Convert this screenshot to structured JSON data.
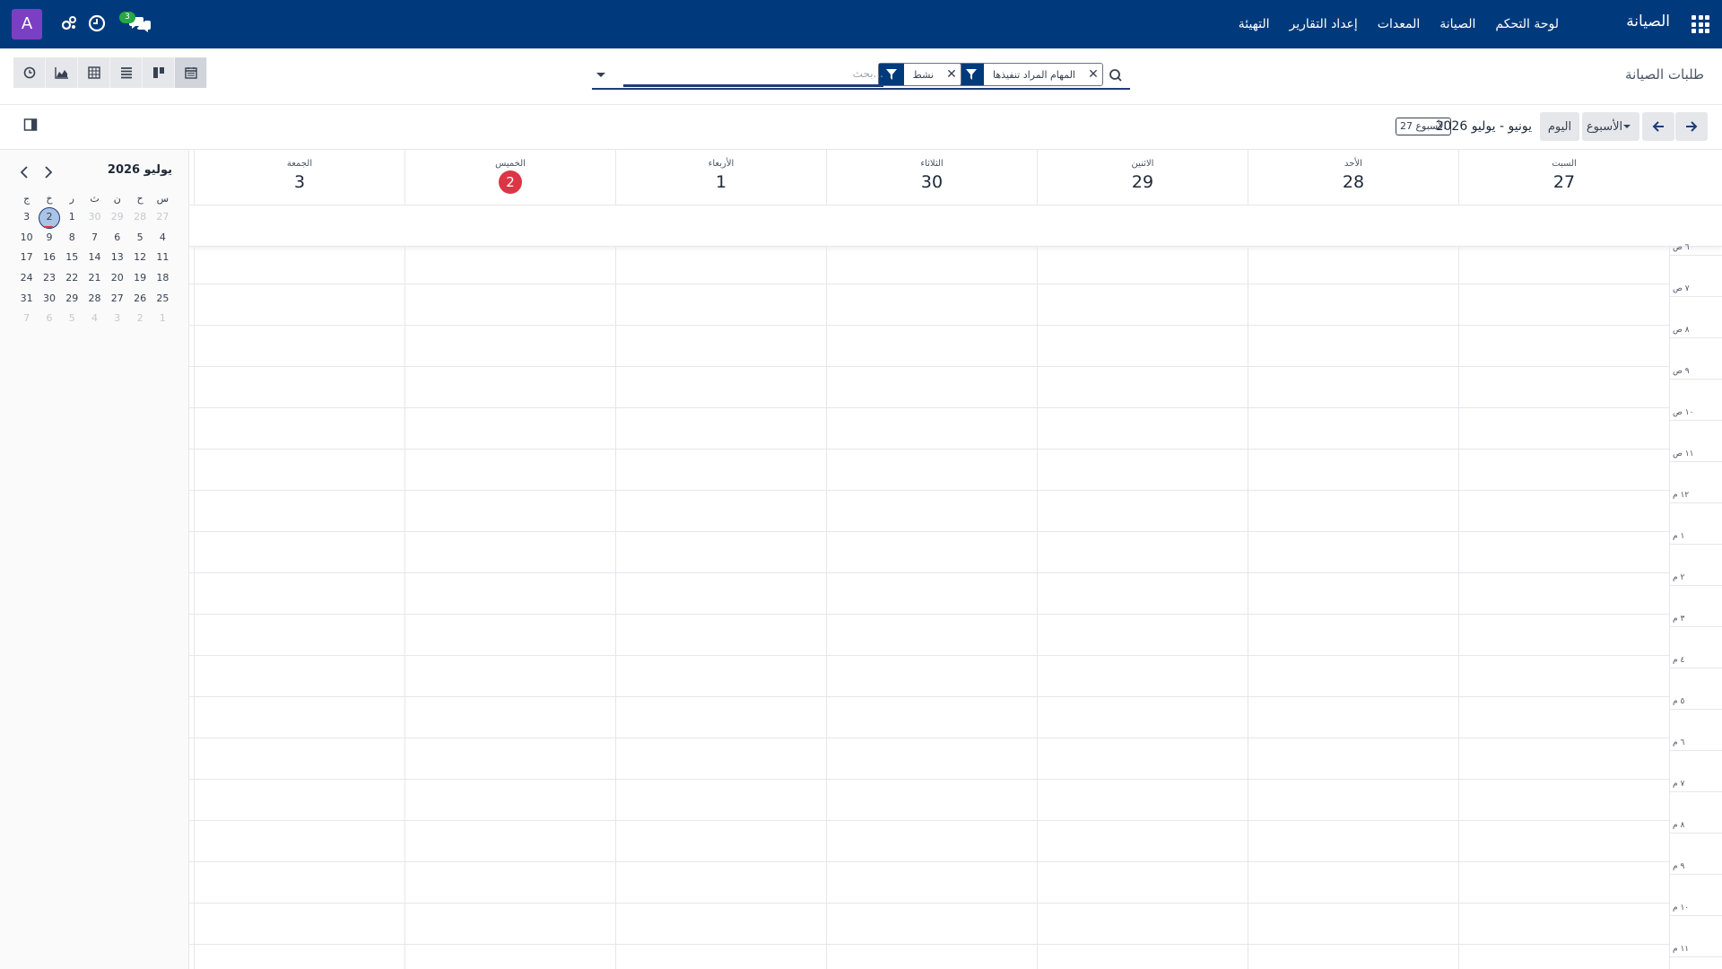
{
  "navbar": {
    "brand": "الصيانة",
    "menu": [
      "لوحة التحكم",
      "الصيانة",
      "المعدات",
      "إعداد التقارير",
      "التهيئة"
    ],
    "avatar_letter": "A",
    "chat_badge": "3",
    "bg_color": "#003a7c"
  },
  "control_panel": {
    "breadcrumb": "طلبات الصيانة",
    "search": {
      "placeholder": "بحث...",
      "facets": [
        {
          "label": "المهام المراد تنفيذها",
          "icon": "filter-icon"
        },
        {
          "label": "نشط",
          "icon": "filter-icon"
        }
      ]
    },
    "views": [
      "calendar-icon",
      "kanban-icon",
      "list-icon",
      "pivot-icon",
      "graph-icon",
      "activity-icon"
    ]
  },
  "calendar_controls": {
    "today_label": "اليوم",
    "scale_label": "الأسبوع",
    "range_label": "يونيو - يوليو 2026",
    "week_badge": "الأسبوع 27"
  },
  "mini_calendar": {
    "title": "يوليو 2026",
    "weekday_headers": [
      "س",
      "ح",
      "ن",
      "ث",
      "ر",
      "خ",
      "ج"
    ],
    "weeks": [
      [
        {
          "d": "27",
          "m": true
        },
        {
          "d": "28",
          "m": true
        },
        {
          "d": "29",
          "m": true
        },
        {
          "d": "30",
          "m": true
        },
        {
          "d": "1",
          "m": false
        },
        {
          "d": "2",
          "m": false,
          "today": true
        },
        {
          "d": "3",
          "m": false
        }
      ],
      [
        {
          "d": "4"
        },
        {
          "d": "5"
        },
        {
          "d": "6"
        },
        {
          "d": "7"
        },
        {
          "d": "8"
        },
        {
          "d": "9"
        },
        {
          "d": "10"
        }
      ],
      [
        {
          "d": "11"
        },
        {
          "d": "12"
        },
        {
          "d": "13"
        },
        {
          "d": "14"
        },
        {
          "d": "15"
        },
        {
          "d": "16"
        },
        {
          "d": "17"
        }
      ],
      [
        {
          "d": "18"
        },
        {
          "d": "19"
        },
        {
          "d": "20"
        },
        {
          "d": "21"
        },
        {
          "d": "22"
        },
        {
          "d": "23"
        },
        {
          "d": "24"
        }
      ],
      [
        {
          "d": "25"
        },
        {
          "d": "26"
        },
        {
          "d": "27"
        },
        {
          "d": "28"
        },
        {
          "d": "29"
        },
        {
          "d": "30"
        },
        {
          "d": "31"
        }
      ],
      [
        {
          "d": "1",
          "m": true
        },
        {
          "d": "2",
          "m": true
        },
        {
          "d": "3",
          "m": true
        },
        {
          "d": "4",
          "m": true
        },
        {
          "d": "5",
          "m": true
        },
        {
          "d": "6",
          "m": true
        },
        {
          "d": "7",
          "m": true
        }
      ]
    ]
  },
  "week_view": {
    "days": [
      {
        "name": "السبت",
        "num": "27"
      },
      {
        "name": "الأحد",
        "num": "28"
      },
      {
        "name": "الاثنين",
        "num": "29"
      },
      {
        "name": "الثلاثاء",
        "num": "30"
      },
      {
        "name": "الأربعاء",
        "num": "1"
      },
      {
        "name": "الخميس",
        "num": "2",
        "today": true
      },
      {
        "name": "الجمعة",
        "num": "3"
      }
    ],
    "hours": [
      "٦ ص",
      "٧ ص",
      "٨ ص",
      "٩ ص",
      "١٠ ص",
      "١١ ص",
      "١٢ م",
      "١ م",
      "٢ م",
      "٣ م",
      "٤ م",
      "٥ م",
      "٦ م",
      "٧ م",
      "٨ م",
      "٩ م",
      "١٠ م",
      "١١ م"
    ],
    "today_color": "#dc3545"
  }
}
